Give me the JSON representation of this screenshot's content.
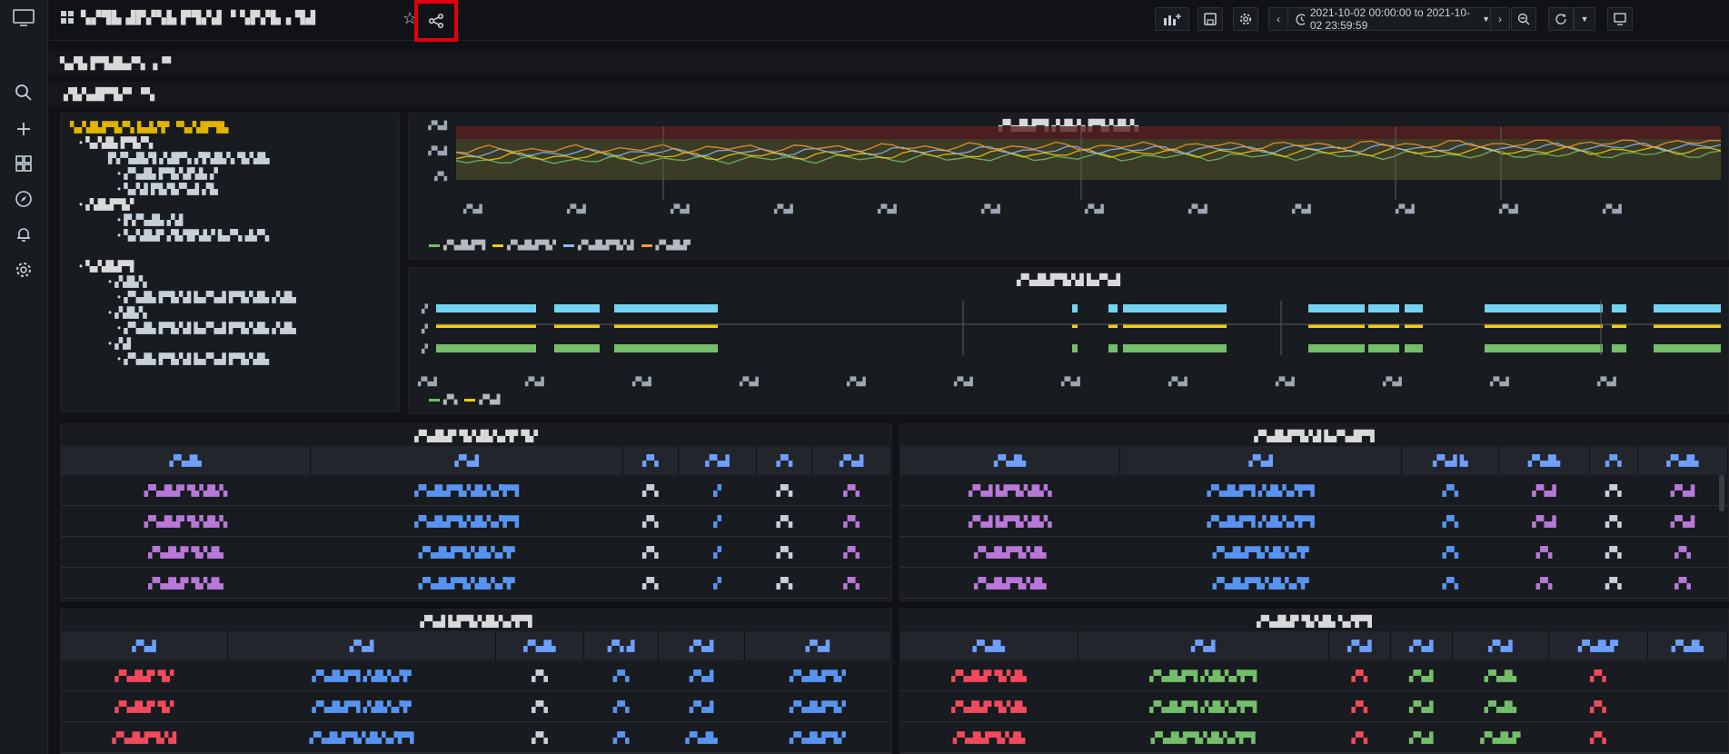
{
  "topbar": {
    "dashboard_title": "▚▞▜▙ ▟▛▞▚▙ ▛▜▞▟ ▝ ▚▛▞▙▗ ▜▟",
    "time_range": "2021-10-02 00:00:00 to 2021-10-02 23:59:59"
  },
  "rows": {
    "row1_title": "▚▞▙ ▛▜▟▙▞▚ ▗▝▘",
    "row2_title": "▞▙▚▟▛▜▞▘▝▚"
  },
  "text_panel": {
    "heading": "▚▞▟▙▛▜▞▚ ▙▟▞▛ ▝▚▞▟▛▜▙",
    "lines": [
      {
        "level": "l1",
        "text": "• ▚▞▟▙ ▛▜▞▚"
      },
      {
        "level": "l2",
        "text": "▛▞▚▟▙▜ ▞▟▛▚ ▞▛▟▙▚ ▜▞▟▙"
      },
      {
        "level": "l3",
        "text": "• ▞▚▟▙ ▛▜▞▟▚▙ ▞"
      },
      {
        "level": "l3",
        "text": "• ▚▞▟ ▛▙▜▞▚▟ ▞▙"
      },
      {
        "level": "l1",
        "text": "• ▞▟▙▛▜▞"
      },
      {
        "level": "l3",
        "text": "• ▛▞▚▟▙ ▞▟"
      },
      {
        "level": "l3",
        "text": "• ▚▞▟▙▛ ▞▙▜▛▟▞ ▙▞▚ ▟▞▚"
      },
      {
        "level": "l1",
        "text": ""
      },
      {
        "level": "l1",
        "text": "• ▚▞▟▙▛▜"
      },
      {
        "level": "l2",
        "text": "• ▞▟▙▚"
      },
      {
        "level": "l3",
        "text": "• ▞▚▟▙ ▛▜▞▟ ▙▞▚▟ ▛▜▞▟▙ ▞▟▙"
      },
      {
        "level": "l2",
        "text": "• ▞▟▙▚"
      },
      {
        "level": "l3",
        "text": "• ▞▚▟▙ ▛▜▞▟ ▙▞▚▟ ▛▜▞▟▙ ▞▟▙"
      },
      {
        "level": "l2",
        "text": "• ▞▟"
      },
      {
        "level": "l3",
        "text": "• ▞▚▟▙ ▛▜▞▟ ▙▞▚▟ ▛▜▞▟▙"
      }
    ]
  },
  "timeseries_panel": {
    "title": "▞▚▟▙▛▜ ▞▟▙▚ ▛▜▞▟▙▚",
    "y_ticks": [
      "▞▚▟",
      "▞▚▟",
      "▞▚"
    ],
    "x_ticks": [
      "▞▚▟",
      "▞▚▟",
      "▞▚▟",
      "▞▚▟",
      "▞▚▟",
      "▞▚▟",
      "▞▚▟",
      "▞▚▟",
      "▞▚▟",
      "▞▚▟",
      "▞▚▟",
      "▞▚▟"
    ],
    "legend": [
      {
        "label": "▞▚▟▙▛▜",
        "color": "#73bf69"
      },
      {
        "label": "▞▚▟▙▛▜▞",
        "color": "#f2cc0c"
      },
      {
        "label": "▞▚▟▙▛▜▞▟",
        "color": "#8ab8ff"
      },
      {
        "label": "▞▚▟▙▛",
        "color": "#ff9830"
      }
    ]
  },
  "state_panel": {
    "title": "▞▚▟▙▛▜▞▟ ▙▞▚▟",
    "y_labels": [
      "▞",
      "▞",
      "▞"
    ],
    "x_ticks": [
      "▞▚▟",
      "▞▚▟",
      "▞▚▟",
      "▞▚▟",
      "▞▚▟",
      "▞▚▟",
      "▞▚▟",
      "▞▚▟",
      "▞▚▟",
      "▞▚▟",
      "▞▚▟",
      "▞▚▟"
    ],
    "legend": [
      {
        "label": "▞▚",
        "color": "#73bf69"
      },
      {
        "label": "▞▚▟",
        "color": "#f2cc0c"
      }
    ]
  },
  "table1": {
    "title": "▞▚▟▙▛ ▜▞▟▙▚▞▛ ▜▞",
    "headers": [
      "▞▚▟▙",
      "▞▚▟",
      "▞▚",
      "▞▚▟",
      "▞▚",
      "▞▚▟"
    ],
    "rows": [
      [
        "▞▚▟▙▛ ▜▞▟▙▚",
        "▞▚▟▙▛▜▞▟▙▚▞▛▜",
        "▞▚",
        "▞",
        "▞▚",
        "▞▚"
      ],
      [
        "▞▚▟▙▛ ▜▞▟▙▚",
        "▞▚▟▙▛▜▞▟▙▚▞▛▜",
        "▞▚",
        "▞",
        "▞▚",
        "▞▚"
      ],
      [
        "▞▚▟▙▛ ▜▞▟▙",
        "▞▚▟▙▛▜▞▟▙▚▞▛",
        "▞▚",
        "▞",
        "▞▚",
        "▞▚"
      ],
      [
        "▞▚▟▙▛ ▜▞▟▙",
        "▞▚▟▙▛▜▞▟▙▚▞▛",
        "▞▚",
        "▞",
        "▞▚",
        "▞▚"
      ]
    ]
  },
  "table2": {
    "title": "▞▚▟▙▛▜▞▟ ▙▞▚▟▛▜",
    "headers": [
      "▞▚▟▙",
      "▞▚▟",
      "▞▚▟ ▙",
      "▞▚▟▙",
      "▞▚",
      "▞▚▟▙"
    ],
    "rows": [
      [
        "▞▚▟ ▙▛▜▞▟▙▚",
        "▞▚▟▙▛▜ ▞▟▙▚▞▛▜",
        "▞▚",
        "▞▚▟",
        "▞▚",
        "▞▚▟"
      ],
      [
        "▞▚▟ ▙▛▜▞▟▙▚",
        "▞▚▟▙▛▜ ▞▟▙▚▞▛▜",
        "▞▚",
        "▞▚▟",
        "▞▚",
        "▞▚▟"
      ],
      [
        "▞▚▟▙▛▜▞▟▙",
        "▞▚▟▙▛▜▞▟▙▚▞▛",
        "▞▚",
        "▞▚",
        "▞▚",
        "▞▚"
      ],
      [
        "▞▚▟▙▛▜▞▟▙",
        "▞▚▟▙▛▜▞▟▙▚▞▛",
        "▞▚",
        "▞▚",
        "▞▚",
        "▞▚"
      ]
    ]
  },
  "table3": {
    "title": "▞▚▟ ▙▛▜▞▟▙▚▞▛▜",
    "headers": [
      "▞▚▟",
      "▞▚▟",
      "▞▚▟▙",
      "▞▚ ▟",
      "▞▚▟",
      "▞▚▟"
    ],
    "rows": [
      [
        "▞▚▟▙▛ ▜▞",
        "▞▚▟▙▛▜ ▞▟▙▚▞▛",
        "▞▚",
        "▞▚",
        "▞▚▟",
        "▞▚▟▙▛▜▞"
      ],
      [
        "▞▚▟▙▛ ▜▞",
        "▞▚▟▙▛▜ ▞▟▙▚▞▛",
        "▞▚",
        "▞▚",
        "▞▚▟",
        "▞▚▟▙▛▜▞"
      ],
      [
        "▞▚▟▙▛▜▞▟",
        "▞▚▟▙▛▜▞▟▙▚▞▛▜",
        "▞▚",
        "▞▚",
        "▞▚▟▙",
        "▞▚▟▙▛▜▞"
      ]
    ]
  },
  "table4": {
    "title": "▞▚▟▙▛ ▜▞▟▙ ▚▞▛▜",
    "headers": [
      "▞▚▟▙",
      "▞▚▟",
      "▞▚▟",
      "▞▚▟",
      "▞▚▟",
      "▞▚▟▙▛",
      "▞▚▟▙"
    ],
    "rows": [
      [
        "▞▚▟▙▛ ▜▞▟▙",
        "▞▚▟▙▛▜ ▞▟▙▚▞▛▜",
        "▞▚",
        "▞▚▟",
        "▞▚▟▙",
        "▞▚",
        ""
      ],
      [
        "▞▚▟▙▛ ▜▞▟▙",
        "▞▚▟▙▛▜ ▞▟▙▚▞▛▜",
        "▞▚",
        "▞▚▟",
        "▞▚▟▙",
        "▞▚",
        ""
      ],
      [
        "▞▚▟▙▛▜▞▟▙",
        "▞▚▟▙▛▜▞▟▙▚▞▛▜",
        "▞▚",
        "▞▚▟",
        "▞▚▟▙▛",
        "▞▚",
        ""
      ]
    ]
  },
  "colors": {
    "accent": "#e3000f",
    "cyan": "#73d3f2",
    "yellow": "#f2cc0c",
    "green": "#73bf69",
    "purple": "#b877d9",
    "blue": "#5794f2",
    "red": "#f2495c"
  }
}
